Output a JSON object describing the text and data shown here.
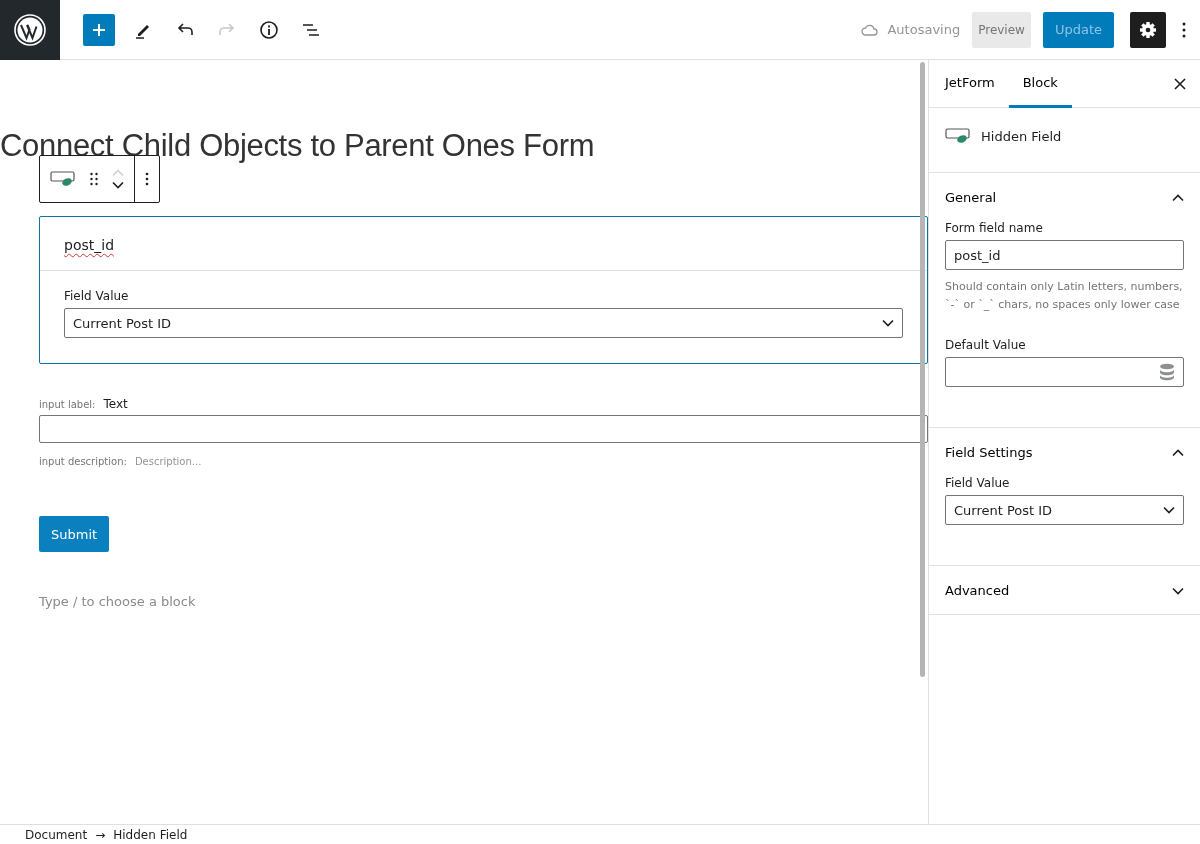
{
  "toolbar": {
    "redo_disabled": true,
    "status": "Autosaving",
    "preview": "Preview",
    "update": "Update",
    "settings_active": true
  },
  "editor": {
    "title": "Connect Child Objects to Parent Ones Form",
    "hidden_field": {
      "name": "post_id",
      "value_label": "Field Value",
      "value": "Current Post ID"
    },
    "text_field": {
      "label_caption": "input label:",
      "label": "Text",
      "description_caption": "input description:",
      "description_placeholder": "Description..."
    },
    "submit": "Submit",
    "appender": "Type / to choose a block"
  },
  "sidebar": {
    "tabs": [
      {
        "label": "JetForm",
        "selected": false
      },
      {
        "label": "Block",
        "selected": true
      }
    ],
    "block_title": "Hidden Field",
    "panels": [
      {
        "title": "General",
        "expanded": true,
        "fields": [
          {
            "kind": "text",
            "label": "Form field name",
            "value": "post_id",
            "help": "Should contain only Latin letters, numbers, `-` or `_` chars, no spaces only lower case"
          },
          {
            "kind": "dynamic",
            "label": "Default Value"
          }
        ]
      },
      {
        "title": "Field Settings",
        "expanded": true,
        "fields": [
          {
            "kind": "select",
            "label": "Field Value",
            "value": "Current Post ID"
          }
        ]
      },
      {
        "title": "Advanced",
        "expanded": false
      }
    ]
  },
  "breadcrumb": {
    "items": [
      "Document",
      "Hidden Field"
    ],
    "separator": "→"
  }
}
